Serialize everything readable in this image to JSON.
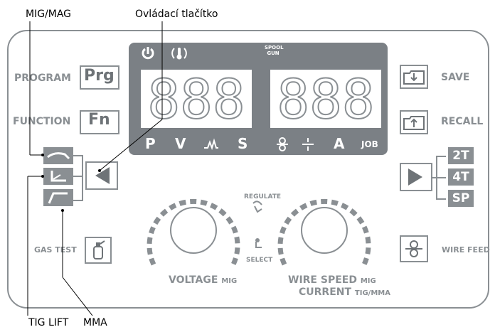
{
  "annotations": {
    "mig_mag": "MIG/MAG",
    "button": "Ovládací tlačítko",
    "tig_lift": "TIG LIFT",
    "mma": "MMA"
  },
  "left_labels": {
    "program": "PROGRAM",
    "program_key": "Prg",
    "function": "FUNCTION",
    "function_key": "Fn",
    "gas_test": "GAS TEST"
  },
  "right_labels": {
    "save": "SAVE",
    "recall": "RECALL",
    "wire_feed": "WIRE FEED",
    "mode_2t": "2T",
    "mode_4t": "4T",
    "mode_sp": "SP"
  },
  "display": {
    "spool_gun": [
      "SPOOL",
      "GUN"
    ],
    "left_digits": "888",
    "right_digits": "888",
    "bottom_left": [
      "P",
      "V",
      "S"
    ],
    "bottom_right": [
      "A",
      "JOB"
    ]
  },
  "knobs": {
    "regulate": "REGULATE",
    "select": "SELECT",
    "voltage": "VOLTAGE",
    "voltage_sub": "MIG",
    "wire_speed": "WIRE SPEED",
    "wire_speed_sub": "MIG",
    "current": "CURRENT",
    "current_sub": "TIG/MMA"
  },
  "colors": {
    "panel_grey": "#8a8f93",
    "display_bg": "#7b8085"
  }
}
